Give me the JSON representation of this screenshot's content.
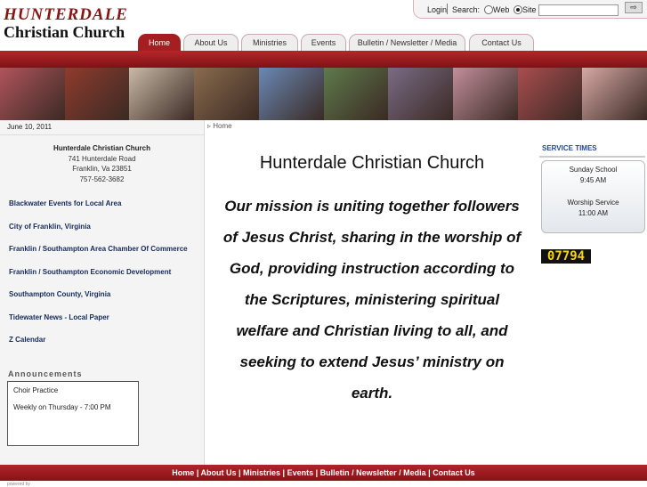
{
  "logo": {
    "line1": "HUNTERDALE",
    "line2": "Christian Church"
  },
  "topbar": {
    "login": "Login",
    "search_label": "Search:",
    "web_label": "Web",
    "site_label": "Site",
    "search_value": "",
    "go_label": "⇨"
  },
  "nav": {
    "tabs": [
      "Home",
      "About Us",
      "Ministries",
      "Events",
      "Bulletin / Newsletter / Media",
      "Contact Us"
    ],
    "active": "Home"
  },
  "photo_colors": [
    "#b0545b",
    "#8f3b2c",
    "#c9b9a6",
    "#8a6b4d",
    "#6a88b5",
    "#5e7a4a",
    "#7a6b85",
    "#c28e9b",
    "#a94d4e",
    "#d7a8a4"
  ],
  "left": {
    "date": "June 10, 2011",
    "address": {
      "name": "Hunterdale Christian Church",
      "street": "741 Hunterdale Road",
      "city": "Franklin, Va 23851",
      "phone": "757-562-3682"
    },
    "links": [
      "Blackwater Events for Local Area",
      "City of Franklin, Virginia",
      "Franklin / Southampton Area Chamber Of Commerce",
      "Franklin / Southampton Economic Development",
      "Southampton County, Virginia",
      "Tidewater News - Local Paper",
      "Z Calendar"
    ],
    "announcements": {
      "title": "Announcements",
      "line1": "Choir Practice",
      "line2": "Weekly on Thursday - 7:00 PM"
    }
  },
  "main": {
    "breadcrumb": "Home",
    "title": "Hunterdale Christian Church",
    "mission_lines": [
      "Our mission is uniting together followers",
      "of Jesus Christ, sharing in the worship of",
      "God, providing instruction according to",
      "the Scriptures, ministering spiritual",
      "welfare and Christian living to all, and",
      "seeking to extend Jesus’ ministry on",
      "earth."
    ]
  },
  "right": {
    "service_title": "SERVICE TIMES",
    "sunday_school": "Sunday School",
    "sunday_time": "9:45 AM",
    "worship": "Worship Service",
    "worship_time": "11:00 AM",
    "counter": "07794"
  },
  "footer": {
    "links": [
      "Home",
      "About Us",
      "Ministries",
      "Events",
      "Bulletin / Newsletter / Media",
      "Contact Us"
    ],
    "powered": "powered by"
  }
}
